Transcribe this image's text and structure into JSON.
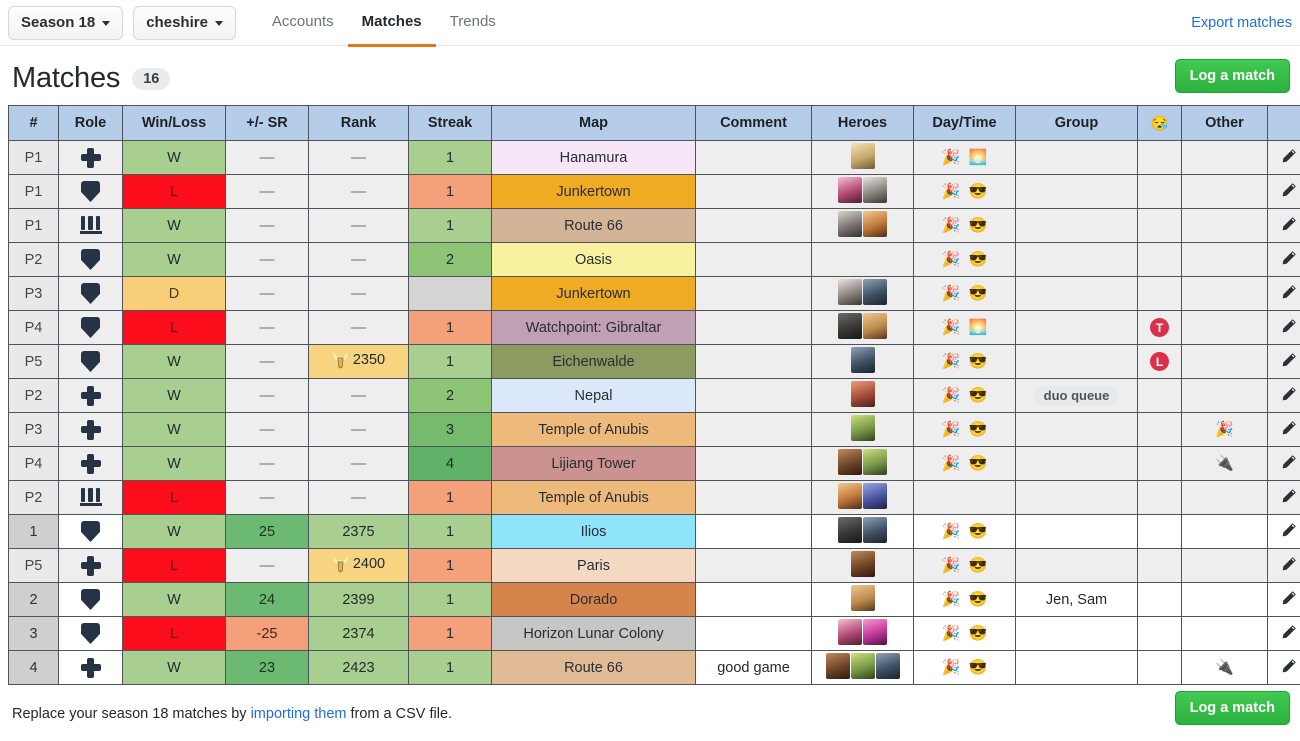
{
  "topbar": {
    "season_selector": "Season 18",
    "account_selector": "cheshire",
    "tabs": [
      {
        "label": "Accounts",
        "active": false
      },
      {
        "label": "Matches",
        "active": true
      },
      {
        "label": "Trends",
        "active": false
      }
    ],
    "export_link": "Export matches"
  },
  "page": {
    "title": "Matches",
    "count": "16",
    "log_button": "Log a match"
  },
  "table": {
    "headers": [
      "#",
      "Role",
      "Win/Loss",
      "+/- SR",
      "Rank",
      "Streak",
      "Map",
      "Comment",
      "Heroes",
      "Day/Time",
      "Group",
      "😪",
      "Other",
      ""
    ],
    "rows": [
      {
        "num": "P1",
        "kind": "placement",
        "role": "support",
        "wl": "W",
        "wl_kind": "w",
        "sr": "—",
        "sr_kind": "dash",
        "rank": "—",
        "rank_kind": "dash",
        "streak": "1",
        "streak_kind": "s1",
        "map": "Hanamura",
        "map_color": "#f7e5f8",
        "comment": "",
        "heroes": [
          "mercy"
        ],
        "daytime": [
          "🎉",
          "🌅"
        ],
        "group": "",
        "group_chip": false,
        "sleep": "",
        "other": ""
      },
      {
        "num": "P1",
        "kind": "placement",
        "role": "tank",
        "wl": "L",
        "wl_kind": "l",
        "sr": "—",
        "sr_kind": "dash",
        "rank": "—",
        "rank_kind": "dash",
        "streak": "1",
        "streak_kind": "s1l",
        "map": "Junkertown",
        "map_color": "#eeab23",
        "comment": "",
        "heroes": [
          "dva",
          "ana"
        ],
        "daytime": [
          "🎉",
          "😎"
        ],
        "group": "",
        "group_chip": false,
        "sleep": "",
        "other": ""
      },
      {
        "num": "P1",
        "kind": "placement",
        "role": "damage",
        "wl": "W",
        "wl_kind": "w",
        "sr": "—",
        "sr_kind": "dash",
        "rank": "—",
        "rank_kind": "dash",
        "streak": "1",
        "streak_kind": "s1",
        "map": "Route 66",
        "map_color": "#d4b496",
        "comment": "",
        "heroes": [
          "soldier",
          "tracer"
        ],
        "daytime": [
          "🎉",
          "😎"
        ],
        "group": "",
        "group_chip": false,
        "sleep": "",
        "other": ""
      },
      {
        "num": "P2",
        "kind": "placement",
        "role": "tank",
        "wl": "W",
        "wl_kind": "w",
        "sr": "—",
        "sr_kind": "dash",
        "rank": "—",
        "rank_kind": "dash",
        "streak": "2",
        "streak_kind": "s2",
        "map": "Oasis",
        "map_color": "#f8f2a0",
        "comment": "",
        "heroes": [],
        "daytime": [
          "🎉",
          "😎"
        ],
        "group": "",
        "group_chip": false,
        "sleep": "",
        "other": ""
      },
      {
        "num": "P3",
        "kind": "placement",
        "role": "tank",
        "wl": "D",
        "wl_kind": "d",
        "sr": "—",
        "sr_kind": "dash",
        "rank": "—",
        "rank_kind": "dash",
        "streak": "",
        "streak_kind": "s0",
        "map": "Junkertown",
        "map_color": "#eeab23",
        "comment": "",
        "heroes": [
          "ana",
          "sigma"
        ],
        "daytime": [
          "🎉",
          "😎"
        ],
        "group": "",
        "group_chip": false,
        "sleep": "",
        "other": ""
      },
      {
        "num": "P4",
        "kind": "placement",
        "role": "tank",
        "wl": "L",
        "wl_kind": "l",
        "sr": "—",
        "sr_kind": "dash",
        "rank": "—",
        "rank_kind": "dash",
        "streak": "1",
        "streak_kind": "s1l",
        "map": "Watchpoint: Gibraltar",
        "map_color": "#bfa0b4",
        "comment": "",
        "heroes": [
          "roadhog",
          "hammond"
        ],
        "daytime": [
          "🎉",
          "🌅"
        ],
        "group": "",
        "group_chip": false,
        "sleep": "T",
        "other": ""
      },
      {
        "num": "P5",
        "kind": "placement",
        "role": "tank",
        "wl": "W",
        "wl_kind": "w",
        "sr": "—",
        "sr_kind": "dash",
        "rank": "2350",
        "rank_kind": "badge",
        "streak": "1",
        "streak_kind": "s1",
        "map": "Eichenwalde",
        "map_color": "#8b9b62",
        "comment": "",
        "heroes": [
          "sigma"
        ],
        "daytime": [
          "🎉",
          "😎"
        ],
        "group": "",
        "group_chip": false,
        "sleep": "L",
        "other": ""
      },
      {
        "num": "P2",
        "kind": "placement",
        "role": "support",
        "wl": "W",
        "wl_kind": "w",
        "sr": "—",
        "sr_kind": "dash",
        "rank": "—",
        "rank_kind": "dash",
        "streak": "2",
        "streak_kind": "s2",
        "map": "Nepal",
        "map_color": "#dbe8fa",
        "comment": "",
        "heroes": [
          "brigitte"
        ],
        "daytime": [
          "🎉",
          "😎"
        ],
        "group": "duo queue",
        "group_chip": true,
        "sleep": "",
        "other": ""
      },
      {
        "num": "P3",
        "kind": "placement",
        "role": "support",
        "wl": "W",
        "wl_kind": "w",
        "sr": "—",
        "sr_kind": "dash",
        "rank": "—",
        "rank_kind": "dash",
        "streak": "3",
        "streak_kind": "s3",
        "map": "Temple of Anubis",
        "map_color": "#eeba7b",
        "comment": "",
        "heroes": [
          "lucio"
        ],
        "daytime": [
          "🎉",
          "😎"
        ],
        "group": "",
        "group_chip": false,
        "sleep": "",
        "other": "🎉"
      },
      {
        "num": "P4",
        "kind": "placement",
        "role": "support",
        "wl": "W",
        "wl_kind": "w",
        "sr": "—",
        "sr_kind": "dash",
        "rank": "—",
        "rank_kind": "dash",
        "streak": "4",
        "streak_kind": "s4",
        "map": "Lijiang Tower",
        "map_color": "#cc9290",
        "comment": "",
        "heroes": [
          "baptiste",
          "lucio"
        ],
        "daytime": [
          "🎉",
          "😎"
        ],
        "group": "",
        "group_chip": false,
        "sleep": "",
        "other": "🔌"
      },
      {
        "num": "P2",
        "kind": "placement",
        "role": "damage",
        "wl": "L",
        "wl_kind": "l",
        "sr": "—",
        "sr_kind": "dash",
        "rank": "—",
        "rank_kind": "dash",
        "streak": "1",
        "streak_kind": "s1l",
        "map": "Temple of Anubis",
        "map_color": "#eeba7b",
        "comment": "",
        "heroes": [
          "tracer",
          "widowmaker"
        ],
        "daytime": [],
        "group": "",
        "group_chip": false,
        "sleep": "",
        "other": ""
      },
      {
        "num": "1",
        "kind": "ranked",
        "role": "tank",
        "wl": "W",
        "wl_kind": "w",
        "sr": "25",
        "sr_kind": "pos",
        "rank": "2375",
        "rank_kind": "val",
        "streak": "1",
        "streak_kind": "s1",
        "map": "Ilios",
        "map_color": "#8fe4f9",
        "comment": "",
        "heroes": [
          "roadhog",
          "sigma"
        ],
        "daytime": [
          "🎉",
          "😎"
        ],
        "group": "",
        "group_chip": false,
        "sleep": "",
        "other": ""
      },
      {
        "num": "P5",
        "kind": "placement",
        "role": "support",
        "wl": "L",
        "wl_kind": "l",
        "sr": "—",
        "sr_kind": "dash",
        "rank": "2400",
        "rank_kind": "badge",
        "streak": "1",
        "streak_kind": "s1l",
        "map": "Paris",
        "map_color": "#f4d9c2",
        "comment": "",
        "heroes": [
          "baptiste"
        ],
        "daytime": [
          "🎉",
          "😎"
        ],
        "group": "",
        "group_chip": false,
        "sleep": "",
        "other": ""
      },
      {
        "num": "2",
        "kind": "ranked",
        "role": "tank",
        "wl": "W",
        "wl_kind": "w",
        "sr": "24",
        "sr_kind": "pos",
        "rank": "2399",
        "rank_kind": "val",
        "streak": "1",
        "streak_kind": "s1",
        "map": "Dorado",
        "map_color": "#d5854c",
        "comment": "",
        "heroes": [
          "hammond"
        ],
        "daytime": [
          "🎉",
          "😎"
        ],
        "group": "Jen, Sam",
        "group_chip": false,
        "sleep": "",
        "other": ""
      },
      {
        "num": "3",
        "kind": "ranked",
        "role": "tank",
        "wl": "L",
        "wl_kind": "l",
        "sr": "-25",
        "sr_kind": "neg",
        "rank": "2374",
        "rank_kind": "val",
        "streak": "1",
        "streak_kind": "s1l",
        "map": "Horizon Lunar Colony",
        "map_color": "#c6c6c4",
        "comment": "",
        "heroes": [
          "dva",
          "zarya"
        ],
        "daytime": [
          "🎉",
          "😎"
        ],
        "group": "",
        "group_chip": false,
        "sleep": "",
        "other": ""
      },
      {
        "num": "4",
        "kind": "ranked",
        "role": "support",
        "wl": "W",
        "wl_kind": "w",
        "sr": "23",
        "sr_kind": "pos",
        "rank": "2423",
        "rank_kind": "val",
        "streak": "1",
        "streak_kind": "s1",
        "map": "Route 66",
        "map_color": "#e0bb96",
        "comment": "good game",
        "heroes": [
          "baptiste",
          "lucio",
          "sigma"
        ],
        "daytime": [
          "🎉",
          "😎"
        ],
        "group": "",
        "group_chip": false,
        "sleep": "",
        "other": "🔌"
      }
    ]
  },
  "footer": {
    "text_before": "Replace your season 18 matches by ",
    "link": "importing them",
    "text_after": " from a CSV file.",
    "log_button": "Log a match"
  },
  "colors": {
    "accent_tab": "#e8741c",
    "link": "#1f6fd6",
    "green_button": "#2bb13f",
    "header_bg": "#b6cdea",
    "win": "#a8cf8f",
    "loss": "#fc0d1b",
    "draw": "#f8cf78",
    "badge_red": "#dc2f4b"
  }
}
